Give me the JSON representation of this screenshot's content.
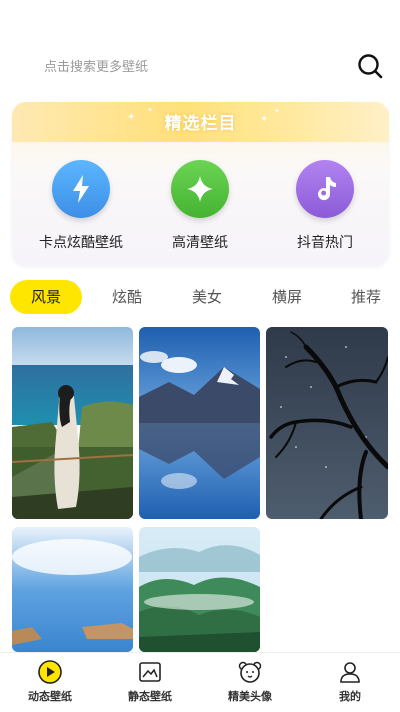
{
  "search": {
    "placeholder": "点击搜索更多壁纸"
  },
  "featured": {
    "title": "精选栏目",
    "categories": [
      {
        "label": "卡点炫酷壁纸",
        "icon": "lightning-icon",
        "color": "#4ea6f2"
      },
      {
        "label": "高清壁纸",
        "icon": "sparkle-icon",
        "color": "#58c443"
      },
      {
        "label": "抖音热门",
        "icon": "music-note-icon",
        "color": "#a373e6"
      }
    ]
  },
  "tabs": [
    "风景",
    "炫酷",
    "美女",
    "横屏",
    "推荐"
  ],
  "active_tab": "风景",
  "wallpapers": [
    {
      "name": "woman-by-sea-wallpaper"
    },
    {
      "name": "mountain-lake-reflection-wallpaper"
    },
    {
      "name": "night-sky-tree-branches-wallpaper"
    },
    {
      "name": "sky-coast-cliffs-wallpaper"
    },
    {
      "name": "misty-mountain-forest-wallpaper"
    }
  ],
  "bottom_nav": [
    {
      "label": "动态壁纸",
      "icon": "play-icon",
      "active": true
    },
    {
      "label": "静态壁纸",
      "icon": "picture-icon",
      "active": false
    },
    {
      "label": "精美头像",
      "icon": "bear-face-icon",
      "active": false
    },
    {
      "label": "我的",
      "icon": "person-icon",
      "active": false
    }
  ],
  "colors": {
    "accent": "#ffe600",
    "text": "#222222",
    "muted": "#9a9a9a"
  }
}
